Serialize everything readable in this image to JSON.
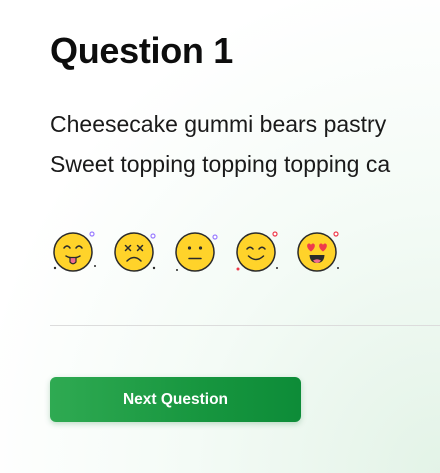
{
  "question": {
    "title": "Question 1",
    "lines": [
      "Cheesecake gummi bears pastry",
      "Sweet topping topping topping ca"
    ]
  },
  "ratings": [
    {
      "name": "tongue-out-face-icon"
    },
    {
      "name": "dizzy-face-icon"
    },
    {
      "name": "neutral-face-icon"
    },
    {
      "name": "smiling-face-icon"
    },
    {
      "name": "heart-eyes-face-icon"
    }
  ],
  "colors": {
    "emoji_fill": "#ffd32a",
    "emoji_stroke": "#2b2b2b",
    "accent_green": "#1c9c45",
    "heart_red": "#ef3b4c",
    "tongue_pink": "#f26d8b"
  },
  "actions": {
    "next_label": "Next Question"
  }
}
